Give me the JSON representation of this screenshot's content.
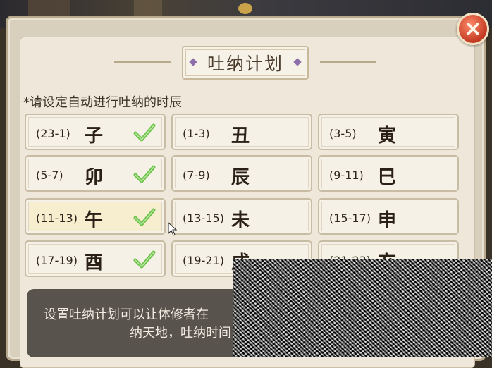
{
  "dialog": {
    "title": "吐纳计划",
    "hint": "*请设定自动进行吐纳的时辰"
  },
  "slots": [
    {
      "range": "(23-1)",
      "name": "子",
      "checked": true
    },
    {
      "range": "(1-3)",
      "name": "丑",
      "checked": false
    },
    {
      "range": "(3-5)",
      "name": "寅",
      "checked": false
    },
    {
      "range": "(5-7)",
      "name": "卯",
      "checked": true
    },
    {
      "range": "(7-9)",
      "name": "辰",
      "checked": false
    },
    {
      "range": "(9-11)",
      "name": "巳",
      "checked": false
    },
    {
      "range": "(11-13)",
      "name": "午",
      "checked": true
    },
    {
      "range": "(13-15)",
      "name": "未",
      "checked": false
    },
    {
      "range": "(15-17)",
      "name": "申",
      "checked": false
    },
    {
      "range": "(17-19)",
      "name": "酉",
      "checked": true
    },
    {
      "range": "(19-21)",
      "name": "戌",
      "checked": false
    },
    {
      "range": "(21-23)",
      "name": "亥",
      "checked": false
    }
  ],
  "tooltip": {
    "line1": "设置吐纳计划可以让体修者在",
    "line2": "纳天地，吐纳时间"
  },
  "colors": {
    "check": "#6cc24a",
    "close": "#c23a22",
    "panel": "#efe8da"
  }
}
